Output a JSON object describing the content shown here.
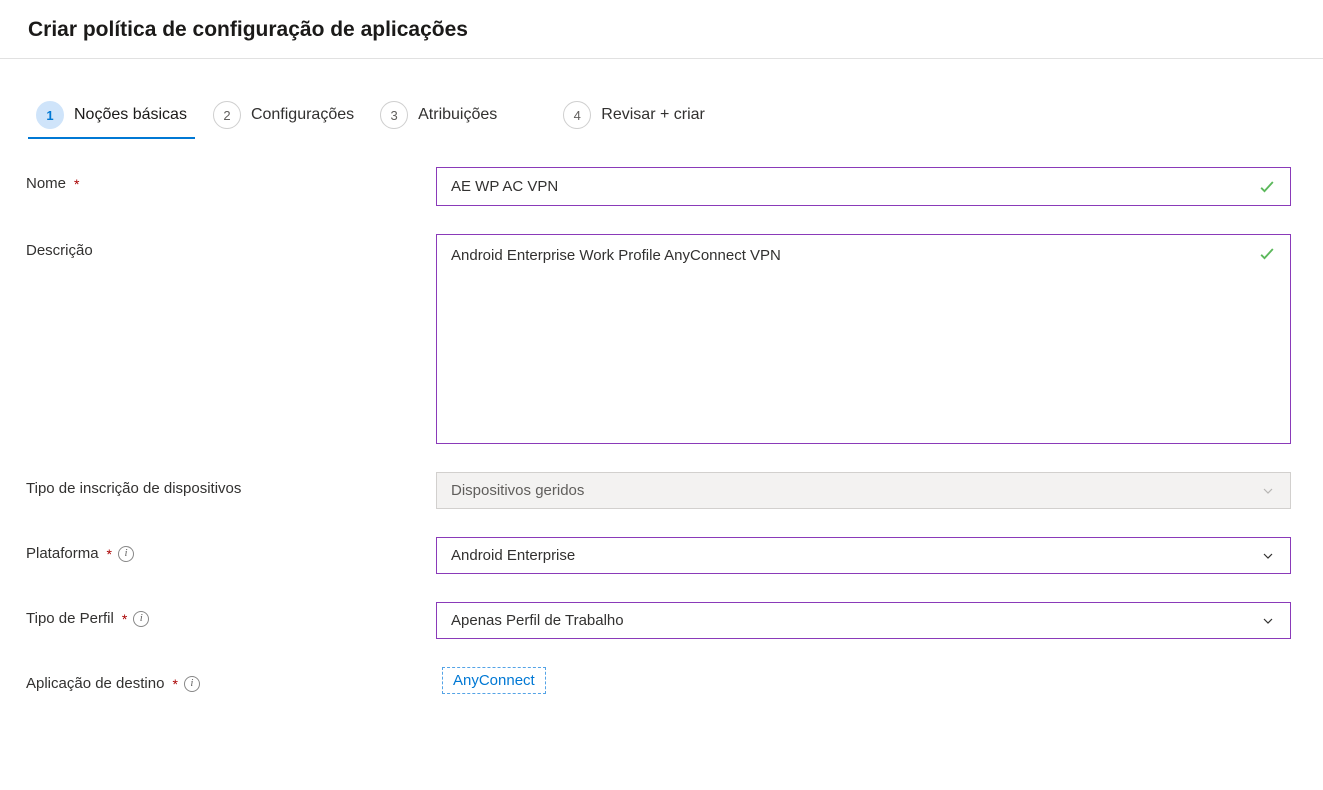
{
  "header": {
    "title": "Criar política de configuração de aplicações"
  },
  "tabs": [
    {
      "step": "1",
      "label": "Noções básicas",
      "active": true
    },
    {
      "step": "2",
      "label": "Configurações",
      "active": false
    },
    {
      "step": "3",
      "label": "Atribuições",
      "active": false
    },
    {
      "step": "4",
      "label": "Revisar + criar",
      "active": false
    }
  ],
  "form": {
    "name": {
      "label": "Nome",
      "value": "AE WP AC VPN",
      "required": true
    },
    "description": {
      "label": "Descrição",
      "value": "Android Enterprise Work Profile AnyConnect VPN",
      "required": false
    },
    "enrollmentType": {
      "label": "Tipo de inscrição de dispositivos",
      "value": "Dispositivos geridos",
      "required": false
    },
    "platform": {
      "label": "Plataforma",
      "value": "Android Enterprise",
      "required": true
    },
    "profileType": {
      "label": "Tipo de Perfil",
      "value": "Apenas Perfil de Trabalho",
      "required": true
    },
    "targetApp": {
      "label": "Aplicação de destino",
      "value": "AnyConnect",
      "required": true
    }
  }
}
